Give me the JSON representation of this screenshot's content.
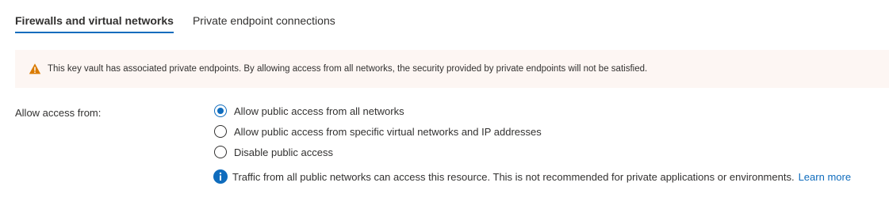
{
  "tabs": [
    {
      "label": "Firewalls and virtual networks",
      "active": true
    },
    {
      "label": "Private endpoint connections",
      "active": false
    }
  ],
  "warning": {
    "icon": "warning-triangle-icon",
    "text": "This key vault has associated private endpoints. By allowing access from all networks, the security provided by private endpoints will not be satisfied."
  },
  "access": {
    "label": "Allow access from:",
    "options": [
      {
        "label": "Allow public access from all networks",
        "selected": true
      },
      {
        "label": "Allow public access from specific virtual networks and IP addresses",
        "selected": false
      },
      {
        "label": "Disable public access",
        "selected": false
      }
    ]
  },
  "info": {
    "icon": "info-icon",
    "text": "Traffic from all public networks can access this resource. This is not recommended for private applications or environments.",
    "link": "Learn more"
  },
  "colors": {
    "accent": "#0f6cbd",
    "warning_bg": "#fdf6f3",
    "warning_icon": "#da7b00"
  }
}
